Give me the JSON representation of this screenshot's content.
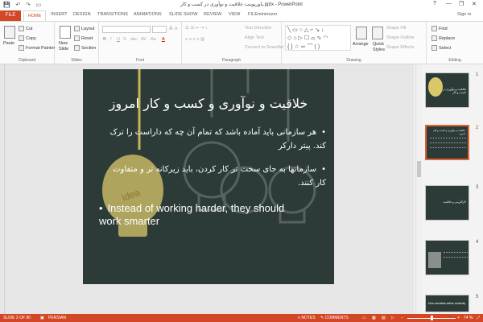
{
  "window": {
    "title": "پاورپوینت خلاقیت و نوآوری در کسب و کار.pptx - PowerPoint",
    "help": "?",
    "minimize": "—",
    "restore": "❐",
    "close": "✕",
    "qat": [
      "💾",
      "↶",
      "↷",
      "▭"
    ]
  },
  "tabs": [
    "FILE",
    "HOME",
    "INSERT",
    "DESIGN",
    "TRANSITIONS",
    "ANIMATIONS",
    "SLIDE SHOW",
    "REVIEW",
    "VIEW",
    "FILEminimizer"
  ],
  "account": {
    "sign_in": "Sign in"
  },
  "ribbon": {
    "clipboard": {
      "label": "Clipboard",
      "paste": "Paste",
      "cut": "Cut",
      "copy": "Copy",
      "format_painter": "Format Painter"
    },
    "slides": {
      "label": "Slides",
      "new_slide": "New",
      "new_slide2": "Slide",
      "layout": "Layout",
      "reset": "Reset",
      "section": "Section"
    },
    "font": {
      "label": "Font",
      "bold": "B",
      "italic": "I",
      "underline": "U",
      "strike": "S",
      "shadow": "abc",
      "spacing": "AV",
      "case": "Aa",
      "color": "A"
    },
    "paragraph": {
      "label": "Paragraph",
      "text_direction": "Text Direction",
      "align_text": "Align Text",
      "convert": "Convert to SmartArt"
    },
    "drawing": {
      "label": "Drawing",
      "arrange": "Arrange",
      "quick_styles": "Quick",
      "quick_styles2": "Styles",
      "shape_fill": "Shape Fill",
      "shape_outline": "Shape Outline",
      "shape_effects": "Shape Effects"
    },
    "editing": {
      "label": "Editing",
      "find": "Find",
      "replace": "Replace",
      "select": "Select"
    }
  },
  "slide": {
    "title": "خلاقیت و نوآوری و کسب و کار امروز",
    "bullets": [
      "هر سازمانی باید آماده باشد که تمام آن چه که داراست را ترک کند.      پیتر دارکر",
      "سازمانها به جای سخت تر کار کردن، باید زیرکانه تر و متفاوت کار کنند."
    ],
    "english_bullet": "Instead of working harder, they should work smarter",
    "bulb_word": "idea"
  },
  "thumbnails": [
    {
      "num": "1",
      "text": "خلاقیت و نوآوری در کسب و کار"
    },
    {
      "num": "2",
      "text": "خلاقیت و نوآوری و کسب و کار امروز"
    },
    {
      "num": "3",
      "text": "کارآفرینی و خلاقیت"
    },
    {
      "num": "4",
      "text": ""
    },
    {
      "num": "5",
      "text": "How scientists define creativity"
    }
  ],
  "status": {
    "slide_info": "SLIDE 2 OF 90",
    "language": "PERSIAN",
    "notes": "NOTES",
    "comments": "COMMENTS",
    "zoom": "74 %"
  },
  "colors": {
    "accent": "#d24726",
    "slide_bg": "#2c3b38"
  }
}
